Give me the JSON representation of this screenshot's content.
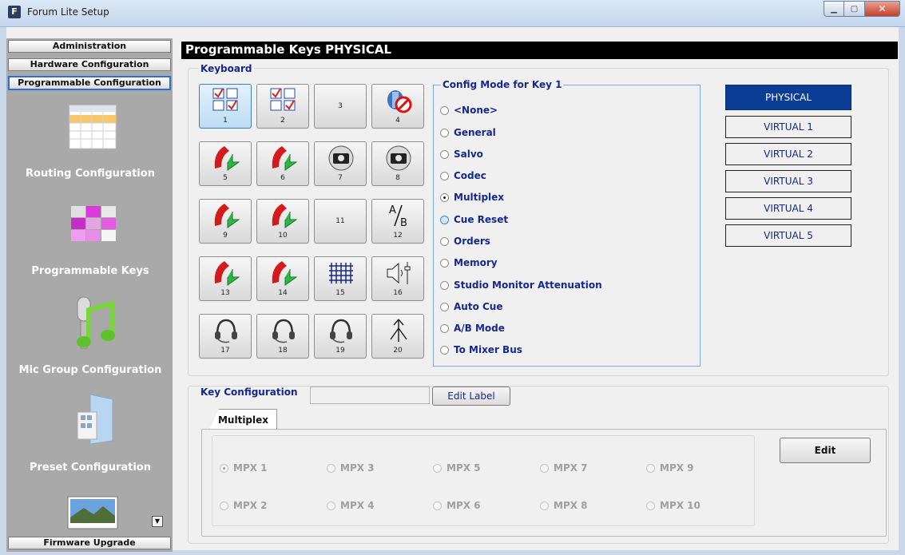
{
  "window": {
    "title": "Forum Lite Setup",
    "icon_letter": "F"
  },
  "sidebar": {
    "top_buttons": [
      "Administration",
      "Hardware Configuration",
      "Programmable Configuration"
    ],
    "active_button": "Programmable Configuration",
    "entries": [
      {
        "label": "Routing Configuration",
        "icon": "routing-grid-icon"
      },
      {
        "label": "Programmable Keys",
        "icon": "programmable-keys-icon"
      },
      {
        "label": "Mic Group Configuration",
        "icon": "mic-music-icon"
      },
      {
        "label": "Preset Configuration",
        "icon": "preset-folder-icon"
      },
      {
        "label": "",
        "icon": "photo-icon"
      }
    ],
    "bottom_button": "Firmware Upgrade",
    "scroll_glyph": "▼"
  },
  "main": {
    "title": "Programmable Keys PHYSICAL",
    "keyboard_label": "Keyboard",
    "keys": [
      {
        "num": "1",
        "icon": "checkbox-grid-icon",
        "selected": true
      },
      {
        "num": "2",
        "icon": "checkbox-grid-icon"
      },
      {
        "num": "3",
        "icon": ""
      },
      {
        "num": "4",
        "icon": "no-phone-icon"
      },
      {
        "num": "5",
        "icon": "phone-arrow-icon"
      },
      {
        "num": "6",
        "icon": "phone-arrow-icon"
      },
      {
        "num": "7",
        "icon": "camera-icon"
      },
      {
        "num": "8",
        "icon": "camera-icon"
      },
      {
        "num": "9",
        "icon": "phone-arrow-icon"
      },
      {
        "num": "10",
        "icon": "phone-arrow-icon"
      },
      {
        "num": "11",
        "icon": ""
      },
      {
        "num": "12",
        "icon": "ab-icon"
      },
      {
        "num": "13",
        "icon": "phone-arrow-icon"
      },
      {
        "num": "14",
        "icon": "phone-arrow-icon"
      },
      {
        "num": "15",
        "icon": "matrix-grid-icon"
      },
      {
        "num": "16",
        "icon": "speaker-fader-icon"
      },
      {
        "num": "17",
        "icon": "headset-icon"
      },
      {
        "num": "18",
        "icon": "headset-icon"
      },
      {
        "num": "19",
        "icon": "headset-icon"
      },
      {
        "num": "20",
        "icon": "merge-arrows-icon"
      }
    ],
    "ab_text": {
      "a": "A",
      "b": "B"
    },
    "config_mode": {
      "title": "Config Mode for Key 1",
      "options": [
        "<None>",
        "General",
        "Salvo",
        "Codec",
        "Multiplex",
        "Cue Reset",
        "Orders",
        "Memory",
        "Studio Monitor Attenuation",
        "Auto Cue",
        "A/B Mode",
        "To Mixer Bus"
      ],
      "selected": "Multiplex",
      "hovered": "Cue Reset"
    },
    "modes": [
      "PHYSICAL",
      "VIRTUAL 1",
      "VIRTUAL 2",
      "VIRTUAL 3",
      "VIRTUAL 4",
      "VIRTUAL 5"
    ],
    "active_mode": "PHYSICAL",
    "key_configuration": {
      "label": "Key Configuration",
      "label_value": "",
      "edit_label_button": "Edit Label",
      "tab": "Multiplex",
      "mpx_options": [
        "MPX 1",
        "MPX 3",
        "MPX 5",
        "MPX 7",
        "MPX 9",
        "MPX 2",
        "MPX 4",
        "MPX 6",
        "MPX 8",
        "MPX 10"
      ],
      "mpx_selected": "MPX 1",
      "edit_button": "Edit"
    }
  },
  "colors": {
    "accent_blue": "#15288f",
    "active_mode_bg": "#0c3d96",
    "sidebar_bg": "#a9a9a9",
    "header_bg": "#000000"
  }
}
